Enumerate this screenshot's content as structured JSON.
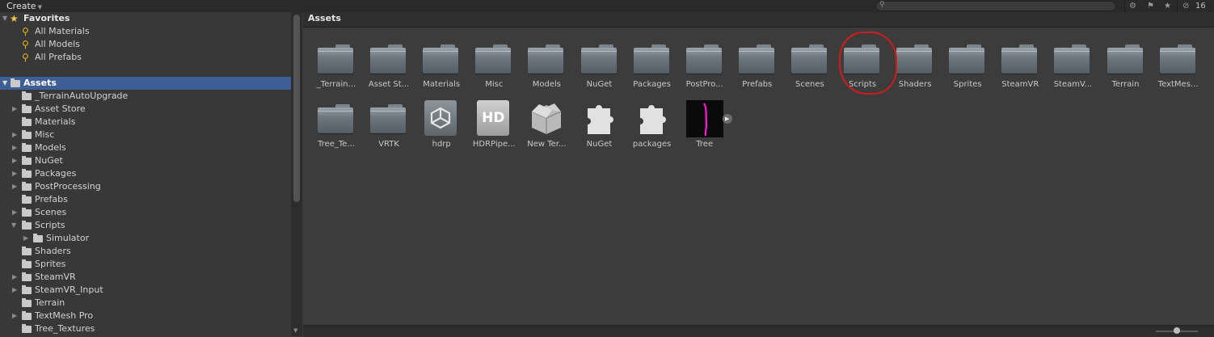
{
  "toolbar": {
    "create_label": "Create",
    "create_caret": "▼",
    "search_value": "",
    "search_icon": "search-icon",
    "hidden_count": "16"
  },
  "tree": {
    "favorites": {
      "label": "Favorites",
      "items": [
        "All Materials",
        "All Models",
        "All Prefabs"
      ]
    },
    "assets": {
      "label": "Assets",
      "items": [
        {
          "label": "_TerrainAutoUpgrade",
          "expandable": false
        },
        {
          "label": "Asset Store",
          "expandable": true
        },
        {
          "label": "Materials",
          "expandable": false
        },
        {
          "label": "Misc",
          "expandable": true
        },
        {
          "label": "Models",
          "expandable": true
        },
        {
          "label": "NuGet",
          "expandable": true
        },
        {
          "label": "Packages",
          "expandable": true
        },
        {
          "label": "PostProcessing",
          "expandable": true
        },
        {
          "label": "Prefabs",
          "expandable": false
        },
        {
          "label": "Scenes",
          "expandable": true
        },
        {
          "label": "Scripts",
          "expandable": true,
          "expanded": true
        },
        {
          "label": "Simulator",
          "expandable": true,
          "child": true
        },
        {
          "label": "Shaders",
          "expandable": false
        },
        {
          "label": "Sprites",
          "expandable": false
        },
        {
          "label": "SteamVR",
          "expandable": true
        },
        {
          "label": "SteamVR_Input",
          "expandable": true
        },
        {
          "label": "Terrain",
          "expandable": false
        },
        {
          "label": "TextMesh Pro",
          "expandable": true
        },
        {
          "label": "Tree_Textures",
          "expandable": false
        }
      ]
    }
  },
  "grid": {
    "breadcrumb": "Assets",
    "row1": [
      {
        "name": "_Terrain...",
        "kind": "folder"
      },
      {
        "name": "Asset St...",
        "kind": "folder"
      },
      {
        "name": "Materials",
        "kind": "folder"
      },
      {
        "name": "Misc",
        "kind": "folder"
      },
      {
        "name": "Models",
        "kind": "folder"
      },
      {
        "name": "NuGet",
        "kind": "folder"
      },
      {
        "name": "Packages",
        "kind": "folder"
      },
      {
        "name": "PostPro...",
        "kind": "folder"
      },
      {
        "name": "Prefabs",
        "kind": "folder"
      },
      {
        "name": "Scenes",
        "kind": "folder"
      },
      {
        "name": "Scripts",
        "kind": "folder",
        "circled": true
      },
      {
        "name": "Shaders",
        "kind": "folder"
      },
      {
        "name": "Sprites",
        "kind": "folder"
      },
      {
        "name": "SteamVR",
        "kind": "folder"
      },
      {
        "name": "SteamV...",
        "kind": "folder"
      },
      {
        "name": "Terrain",
        "kind": "folder"
      },
      {
        "name": "TextMes...",
        "kind": "folder"
      }
    ],
    "row2": [
      {
        "name": "Tree_Te...",
        "kind": "folder"
      },
      {
        "name": "VRTK",
        "kind": "folder"
      },
      {
        "name": "hdrp",
        "kind": "unity-icon"
      },
      {
        "name": "HDRPipe...",
        "kind": "hd-icon",
        "icon_text": "HD"
      },
      {
        "name": "New Ter...",
        "kind": "box-icon"
      },
      {
        "name": "NuGet",
        "kind": "puzzle-icon"
      },
      {
        "name": "packages",
        "kind": "puzzle-icon"
      },
      {
        "name": "Tree",
        "kind": "tree-thumbnail"
      }
    ]
  },
  "colors": {
    "selection": "#3e5f96",
    "annotation_circle": "#d21b1b",
    "favorite_star": "#f2c64b",
    "tree_thumbnail_accent": "#ff1ad9"
  }
}
